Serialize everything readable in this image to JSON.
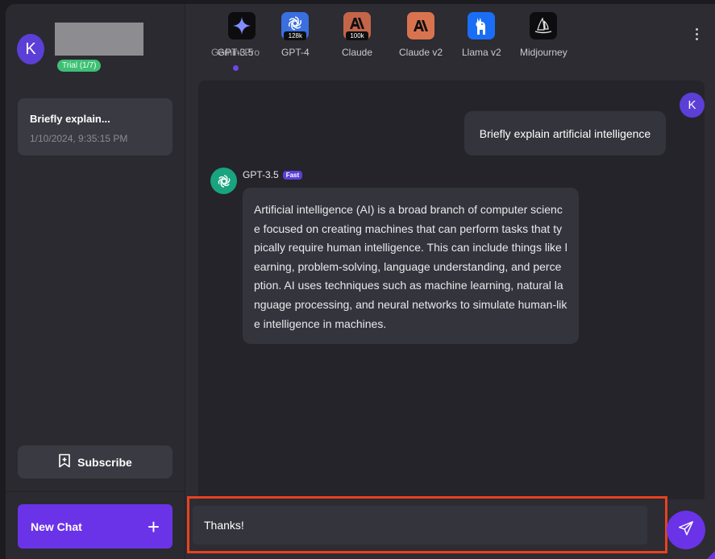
{
  "sidebar": {
    "avatar_letter": "K",
    "trial_badge": "Trial (1/7)",
    "chats": [
      {
        "title": "Briefly explain...",
        "time": "1/10/2024, 9:35:15 PM"
      }
    ],
    "subscribe_label": "Subscribe",
    "new_chat_label": "New Chat"
  },
  "models": [
    {
      "label": "GPT-3.5",
      "overlap_label": "Gemini Pro",
      "icon": "gemini-sparkle-icon",
      "color": "#0d0d10"
    },
    {
      "label": "GPT-4",
      "badge": "128k",
      "icon": "openai-icon",
      "color": "#3a6fe0"
    },
    {
      "label": "Claude",
      "badge": "100k",
      "icon": "anthropic-icon",
      "color": "#c4654a"
    },
    {
      "label": "Claude v2",
      "icon": "anthropic-icon",
      "color": "#d9734f"
    },
    {
      "label": "Llama v2",
      "icon": "llama-icon",
      "color": "#1a6ef5"
    },
    {
      "label": "Midjourney",
      "icon": "midjourney-sail-icon",
      "color": "#0d0d10"
    }
  ],
  "conversation": {
    "user_avatar_letter": "K",
    "user_message": "Briefly explain artificial intelligence",
    "bot_name": "GPT-3.5",
    "bot_badge": "Fast",
    "bot_message": "Artificial intelligence (AI) is a broad branch of computer science focused on creating machines that can perform tasks that typically require human intelligence. This can include things like learning, problem-solving, language understanding, and perception. AI uses techniques such as machine learning, natural language processing, and neural networks to simulate human-like intelligence in machines."
  },
  "input": {
    "value": "Thanks!"
  },
  "colors": {
    "accent": "#6a33e8",
    "highlight": "#e8421f",
    "trial": "#3fbf75"
  }
}
